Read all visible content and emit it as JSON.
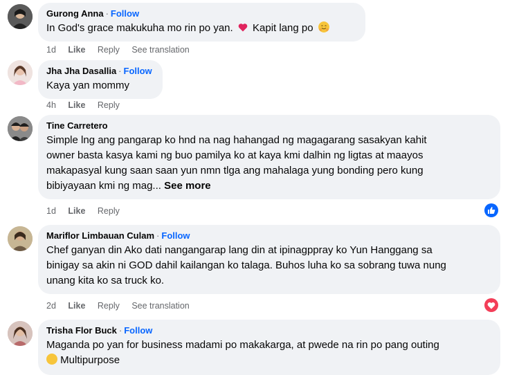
{
  "comments": [
    {
      "author": "Gurong Anna",
      "follow": "Follow",
      "text_before": "In God's grace makukuha mo rin po yan.",
      "text_after": "Kapit lang po",
      "heart_emoji": "heart-emoji",
      "hug_emoji": "hugging-face-emoji",
      "time": "1d",
      "like": "Like",
      "reply": "Reply",
      "see_translation": "See translation"
    },
    {
      "author": "Jha Jha Dasallia",
      "follow": "Follow",
      "text": "Kaya yan mommy",
      "time": "4h",
      "like": "Like",
      "reply": "Reply"
    },
    {
      "author": "Tine Carretero",
      "text_lines": [
        "Simple lng ang pangarap ko hnd na nag hahangad ng magagarang sasakyan kahit",
        "owner basta kasya kami ng buo pamilya ko at kaya kmi dalhin ng ligtas at maayos",
        "makapasyal kung saan saan yun nmn tlga ang mahalaga yung bonding pero kung",
        "bibiyayaan kmi ng mag..."
      ],
      "see_more": "See more",
      "time": "1d",
      "like": "Like",
      "reply": "Reply",
      "reaction": "like-reaction"
    },
    {
      "author": "Mariflor Limbauan Culam",
      "follow": "Follow",
      "text_lines": [
        "Chef ganyan din Ako dati nangangarap lang din at ipinagppray ko Yun Hanggang sa",
        "binigay sa akin ni GOD dahil kailangan ko talaga. Buhos luha ko sa sobrang tuwa nung",
        "unang kita ko sa truck ko."
      ],
      "time": "2d",
      "like": "Like",
      "reply": "Reply",
      "see_translation": "See translation",
      "reaction": "love-reaction"
    },
    {
      "author": "Trisha Flor Buck",
      "follow": "Follow",
      "text_lines": [
        "Maganda po yan for business madami po makakarga, at pwede na rin po pang outing",
        "Multipurpose"
      ]
    }
  ],
  "separator": "·",
  "colors": {
    "link": "#0866ff",
    "bubble": "#f0f2f5",
    "meta": "#65676b",
    "like_blue": "#0866ff",
    "love_red": "#f33e58"
  }
}
